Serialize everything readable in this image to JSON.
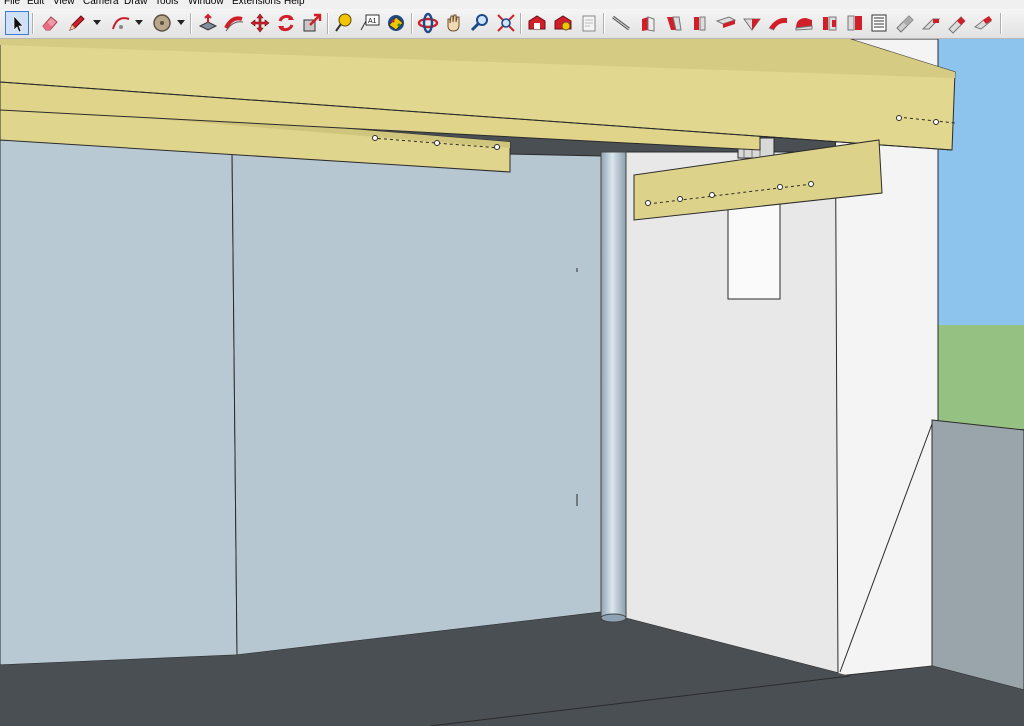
{
  "menu": {
    "items": [
      {
        "key": "file",
        "label": "File"
      },
      {
        "key": "edit",
        "label": "Edit"
      },
      {
        "key": "view",
        "label": "View"
      },
      {
        "key": "camera",
        "label": "Camera"
      },
      {
        "key": "draw",
        "label": "Draw"
      },
      {
        "key": "tools",
        "label": "Tools"
      },
      {
        "key": "window",
        "label": "Window"
      },
      {
        "key": "extensions",
        "label": "Extensions"
      },
      {
        "key": "help",
        "label": "Help"
      }
    ]
  },
  "toolbar": {
    "selected_tool": "select",
    "tools": [
      {
        "name": "select-tool-button",
        "icon": "cursor-arrow-icon"
      },
      {
        "name": "eraser-tool-button",
        "icon": "eraser-icon"
      },
      {
        "name": "pencil-tool-button",
        "icon": "pencil-icon"
      },
      {
        "name": "arc-tool-button",
        "icon": "arc-icon"
      },
      {
        "name": "circle-tool-button",
        "icon": "circle-icon"
      },
      {
        "name": "pushpull-tool-button",
        "icon": "push-pull-icon"
      },
      {
        "name": "followme-tool-button",
        "icon": "follow-me-icon"
      },
      {
        "name": "move-tool-button",
        "icon": "move-arrows-icon"
      },
      {
        "name": "rotate-tool-button",
        "icon": "rotate-icon"
      },
      {
        "name": "scale-tool-button",
        "icon": "scale-icon"
      },
      {
        "name": "tape-measure-button",
        "icon": "tape-measure-icon"
      },
      {
        "name": "text-tool-button",
        "icon": "text-label-icon"
      },
      {
        "name": "paint-bucket-button",
        "icon": "paint-bucket-icon"
      },
      {
        "name": "orbit-tool-button",
        "icon": "orbit-icon"
      },
      {
        "name": "pan-tool-button",
        "icon": "hand-icon"
      },
      {
        "name": "zoom-tool-button",
        "icon": "magnifier-icon"
      },
      {
        "name": "zoom-extents-button",
        "icon": "zoom-extents-icon"
      },
      {
        "name": "warehouse-button",
        "icon": "warehouse-icon"
      },
      {
        "name": "extension-warehouse-button",
        "icon": "extension-warehouse-icon"
      },
      {
        "name": "send-to-layout-button",
        "icon": "layout-icon"
      },
      {
        "name": "section-plane-button",
        "icon": "section-plane-icon"
      },
      {
        "name": "wood-joint-1-button",
        "icon": "joint-red-icon"
      },
      {
        "name": "wood-joint-2-button",
        "icon": "joint-red-icon"
      },
      {
        "name": "wood-joint-3-button",
        "icon": "joint-red-icon"
      },
      {
        "name": "wood-joint-4-button",
        "icon": "joint-red-icon"
      },
      {
        "name": "wood-joint-5-button",
        "icon": "joint-red-icon"
      },
      {
        "name": "wood-joint-6-button",
        "icon": "joint-red-icon"
      },
      {
        "name": "wood-joint-7-button",
        "icon": "joint-red-icon"
      },
      {
        "name": "wood-joint-8-button",
        "icon": "joint-red-icon"
      },
      {
        "name": "wood-joint-9-button",
        "icon": "joint-red-icon"
      },
      {
        "name": "wood-list-button",
        "icon": "cut-list-icon"
      },
      {
        "name": "wood-joint-10-button",
        "icon": "joint-red-icon"
      },
      {
        "name": "wood-joint-11-button",
        "icon": "joint-red-icon"
      },
      {
        "name": "wood-joint-12-button",
        "icon": "joint-red-icon"
      },
      {
        "name": "wood-joint-13-button",
        "icon": "joint-red-icon"
      }
    ]
  },
  "scene": {
    "description_colors": {
      "sky": "#8cc4ee",
      "grass": "#95c182",
      "wall_blue": "#b7c7d1",
      "wall_white": "#e8e8e8",
      "floor": "#4a4f54",
      "timber": "#e0d58c",
      "accent_red": "#e02020",
      "selection_blue": "#3d7bd6"
    }
  }
}
